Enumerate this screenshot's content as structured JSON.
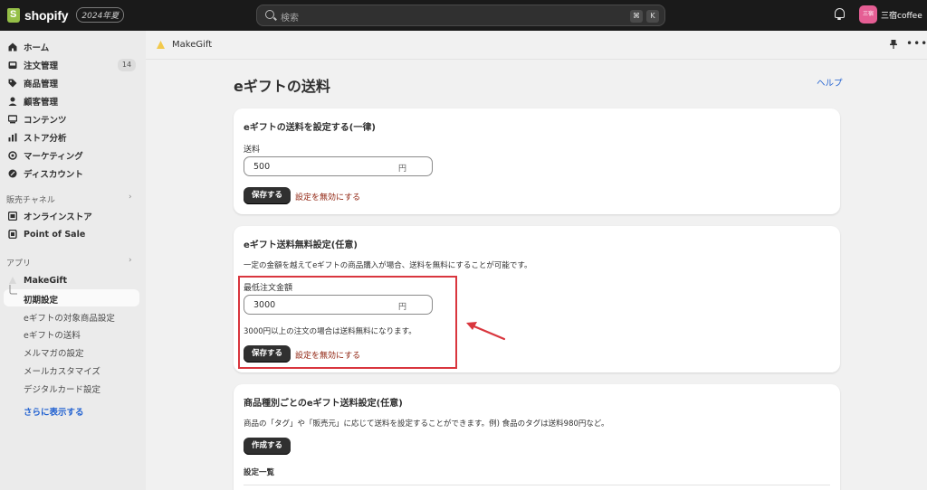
{
  "topbar": {
    "brand": "shopify",
    "badge": "2024年夏",
    "search_placeholder": "検索",
    "kbd1": "⌘",
    "kbd2": "K",
    "avatar_text": "三宿coffe",
    "store_name": "三宿coffee"
  },
  "sidebar": {
    "items": [
      {
        "label": "ホーム",
        "icon": "home-icon"
      },
      {
        "label": "注文管理",
        "icon": "inbox-icon",
        "count": "14"
      },
      {
        "label": "商品管理",
        "icon": "tag-icon"
      },
      {
        "label": "顧客管理",
        "icon": "person-icon"
      },
      {
        "label": "コンテンツ",
        "icon": "content-icon"
      },
      {
        "label": "ストア分析",
        "icon": "chart-icon"
      },
      {
        "label": "マーケティング",
        "icon": "target-icon"
      },
      {
        "label": "ディスカウント",
        "icon": "discount-icon"
      }
    ],
    "sales_channels_title": "販売チャネル",
    "channels": [
      {
        "label": "オンラインストア",
        "icon": "store-icon"
      },
      {
        "label": "Point of Sale",
        "icon": "pos-icon"
      }
    ],
    "apps_title": "アプリ",
    "app_name": "MakeGift",
    "sub_items": [
      "初期設定",
      "eギフトの対象商品設定",
      "eギフトの送料",
      "メルマガの設定",
      "メールカスタマイズ",
      "デジタルカード設定"
    ],
    "more": "さらに表示する"
  },
  "header": {
    "app_title": "MakeGift"
  },
  "page": {
    "title": "eギフトの送料",
    "help": "ヘルプ"
  },
  "card1": {
    "title": "eギフトの送料を設定する(一律)",
    "field_label": "送料",
    "value": "500",
    "suffix": "円",
    "save": "保存する",
    "disable": "設定を無効にする"
  },
  "card2": {
    "title": "eギフト送料無料設定(任意)",
    "description": "一定の金額を越えてeギフトの商品購入が場合、送料を無料にすることが可能です。",
    "field_label": "最低注文金額",
    "value": "3000",
    "suffix": "円",
    "help_text": "3000円以上の注文の場合は送料無料になります。",
    "save": "保存する",
    "disable": "設定を無効にする"
  },
  "card3": {
    "title": "商品種別ごとのeギフト送料設定(任意)",
    "description": "商品の「タグ」や「販売元」に応じて送料を設定することができます。例) 食品のタグは送料980円など。",
    "create": "作成する",
    "list_title": "設定一覧"
  },
  "colors": {
    "accent_red": "#d9363e",
    "link_blue": "#2463d1",
    "critical": "#8e1f0b"
  }
}
